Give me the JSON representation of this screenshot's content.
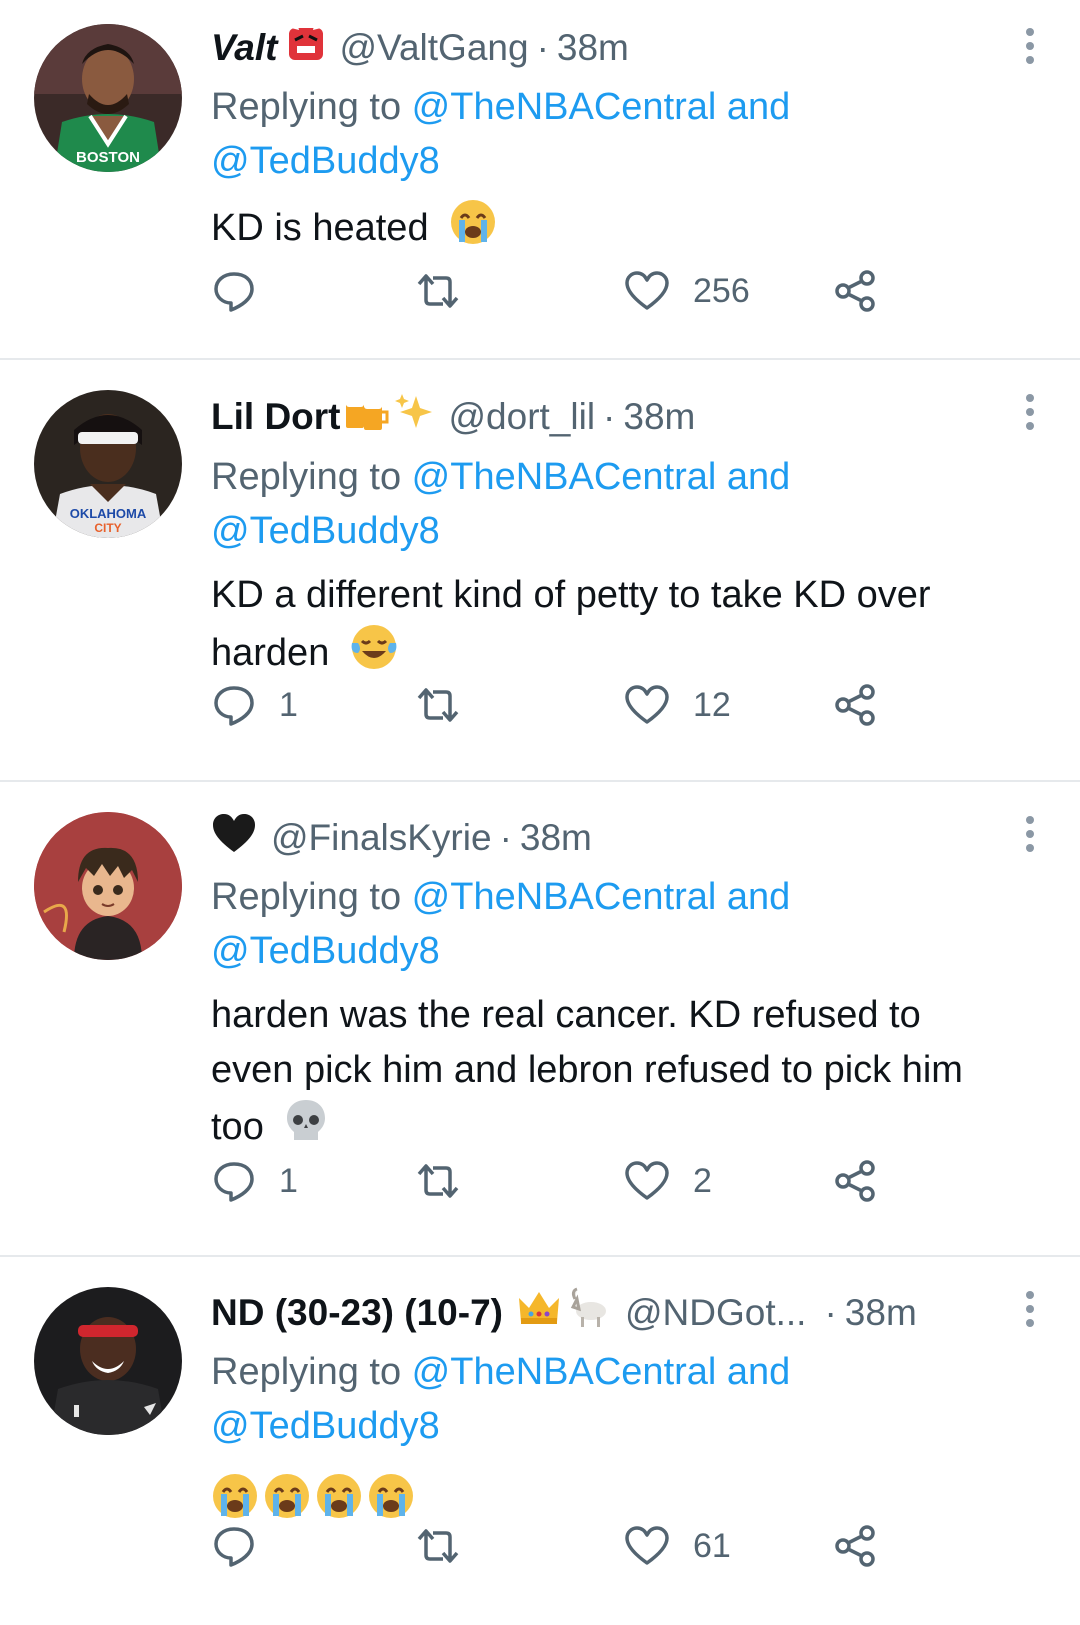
{
  "tweets": [
    {
      "name": "Valt",
      "handle": "@ValtGang",
      "time": "38m",
      "replying_prefix": "Replying to ",
      "reply_to_1": "@TheNBACentral and",
      "reply_to_2": "@TedBuddy8",
      "text": "KD is heated",
      "replies": "",
      "likes": "256"
    },
    {
      "name": "Lil Dort",
      "handle": "@dort_lil",
      "time": "38m",
      "replying_prefix": "Replying to ",
      "reply_to_1": "@TheNBACentral and",
      "reply_to_2": "@TedBuddy8",
      "text_line1": "KD a different kind of petty to take KD over",
      "text_line2": "harden",
      "replies": "1",
      "likes": "12"
    },
    {
      "name": "",
      "handle": "@FinalsKyrie",
      "time": "38m",
      "replying_prefix": "Replying to ",
      "reply_to_1": "@TheNBACentral and",
      "reply_to_2": "@TedBuddy8",
      "text_line1": "harden was the real cancer. KD refused to",
      "text_line2": "even pick him and lebron refused to pick him",
      "text_line3": "too",
      "replies": "1",
      "likes": "2"
    },
    {
      "name": "ND (30-23) (10-7)",
      "handle": "@NDGot...",
      "time": "38m",
      "replying_prefix": "Replying to ",
      "reply_to_1": "@TheNBACentral and",
      "reply_to_2": "@TedBuddy8",
      "replies": "",
      "likes": "61"
    }
  ],
  "icons": [
    "reply-icon",
    "retweet-icon",
    "like-icon",
    "share-icon",
    "more-options-icon"
  ],
  "colors": {
    "link": "#1d9bf0",
    "secondary": "#536471",
    "divider": "#e6e9ec"
  }
}
